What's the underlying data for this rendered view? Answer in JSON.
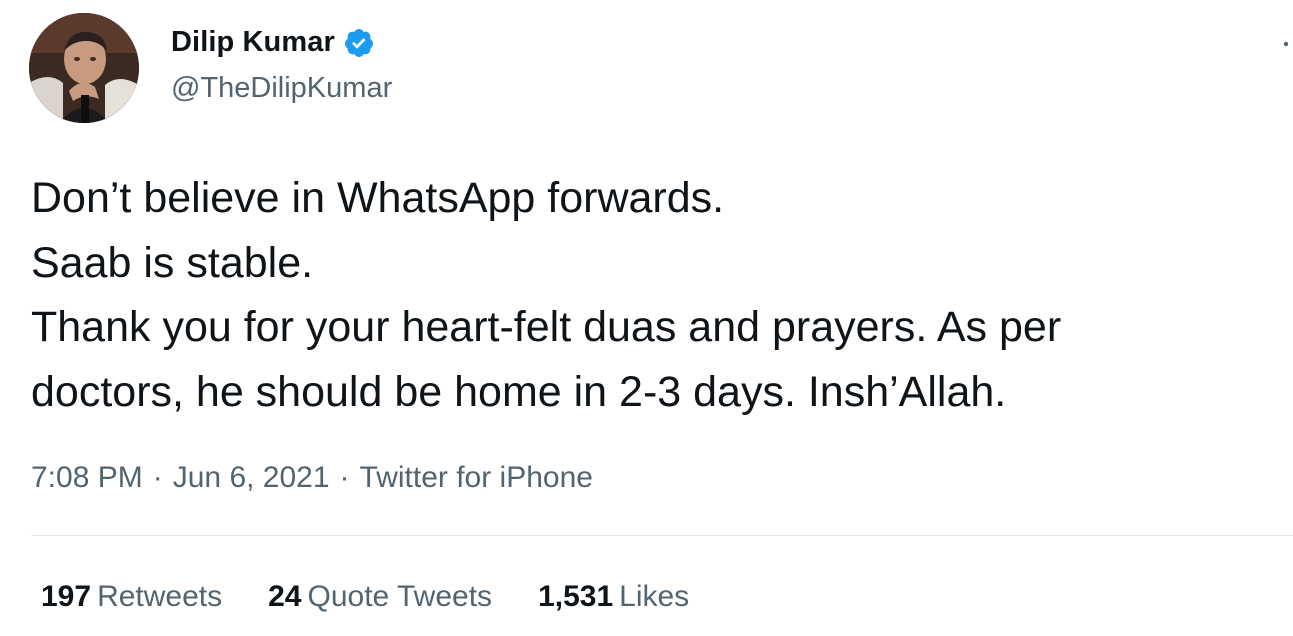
{
  "author": {
    "display_name": "Dilip Kumar",
    "handle": "@TheDilipKumar",
    "verified": true,
    "avatar_icon": "profile-photo",
    "verified_icon": "verified-badge-icon"
  },
  "tweet": {
    "lines": [
      "Don’t believe in WhatsApp forwards.",
      "Saab is stable.",
      "Thank you for your heart-felt duas and prayers. As per",
      "doctors, he should be home in 2-3 days. Insh’Allah."
    ]
  },
  "meta": {
    "time": "7:08 PM",
    "separator": "·",
    "date": "Jun 6, 2021",
    "source": "Twitter for iPhone"
  },
  "stats": {
    "retweets": {
      "count": "197",
      "label": "Retweets"
    },
    "quote_tweets": {
      "count": "24",
      "label": "Quote Tweets"
    },
    "likes": {
      "count": "1,531",
      "label": "Likes"
    }
  },
  "colors": {
    "text": "#0f1419",
    "secondary": "#536471",
    "verified": "#1d9bf0",
    "divider": "#e7e9ea"
  }
}
